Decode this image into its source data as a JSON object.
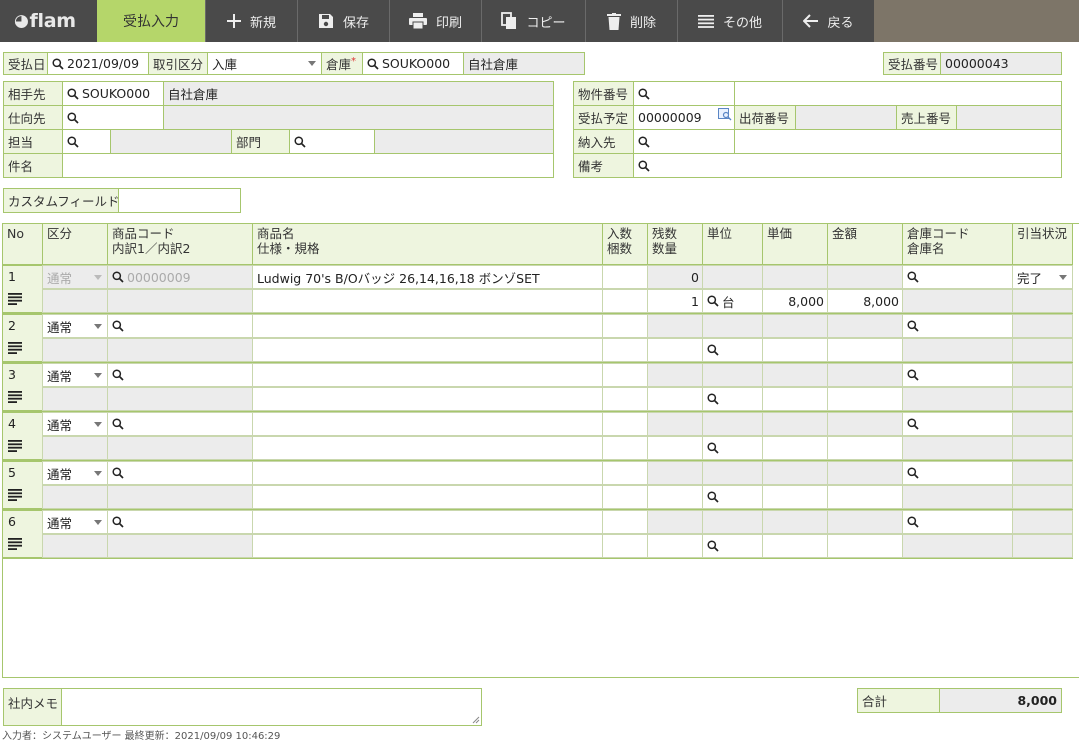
{
  "app": {
    "logo": "flam",
    "active_tab": "受払入力"
  },
  "toolbar": {
    "new": "新規",
    "save": "保存",
    "print": "印刷",
    "copy": "コピー",
    "delete": "削除",
    "other": "その他",
    "back": "戻る"
  },
  "header": {
    "date_label": "受払日",
    "date_value": "2021/09/09",
    "type_label": "取引区分",
    "type_value": "入庫",
    "warehouse_label": "倉庫",
    "warehouse_required": "*",
    "warehouse_code": "SOUKO000",
    "warehouse_name": "自社倉庫",
    "number_label": "受払番号",
    "number_value": "00000043"
  },
  "form": {
    "partner_label": "相手先",
    "partner_code": "SOUKO000",
    "partner_name": "自社倉庫",
    "dest_label": "仕向先",
    "staff_label": "担当",
    "dept_label": "部門",
    "subject_label": "件名",
    "property_label": "物件番号",
    "schedule_label": "受払予定",
    "schedule_value": "00000009",
    "ship_label": "出荷番号",
    "sales_label": "売上番号",
    "delivery_label": "納入先",
    "remarks_label": "備考",
    "custom_label": "カスタムフィールド"
  },
  "table": {
    "headers": {
      "no": "No",
      "kbn": "区分",
      "code1": "商品コード",
      "code2": "内訳1／内訳2",
      "name1": "商品名",
      "name2": "仕様・規格",
      "qty1": "入数",
      "qty2": "梱数",
      "rem1": "残数",
      "rem2": "数量",
      "unit": "単位",
      "price": "単価",
      "amount": "金額",
      "wh1": "倉庫コード",
      "wh2": "倉庫名",
      "status": "引当状況"
    },
    "rows": [
      {
        "no": "1",
        "kbn": "通常",
        "code": "00000009",
        "name": "Ludwig 70's B/Oバッジ 26,14,16,18 ボンゾSET",
        "remain": "0",
        "qty": "1",
        "unit": "台",
        "price": "8,000",
        "amount": "8,000",
        "status": "完了"
      },
      {
        "no": "2",
        "kbn": "通常"
      },
      {
        "no": "3",
        "kbn": "通常"
      },
      {
        "no": "4",
        "kbn": "通常"
      },
      {
        "no": "5",
        "kbn": "通常"
      },
      {
        "no": "6",
        "kbn": "通常"
      }
    ]
  },
  "footer": {
    "memo_label": "社内メモ",
    "total_label": "合計",
    "total_value": "8,000",
    "info": "入力者：システムユーザー 最終更新：2021/09/09 10:46:29"
  }
}
